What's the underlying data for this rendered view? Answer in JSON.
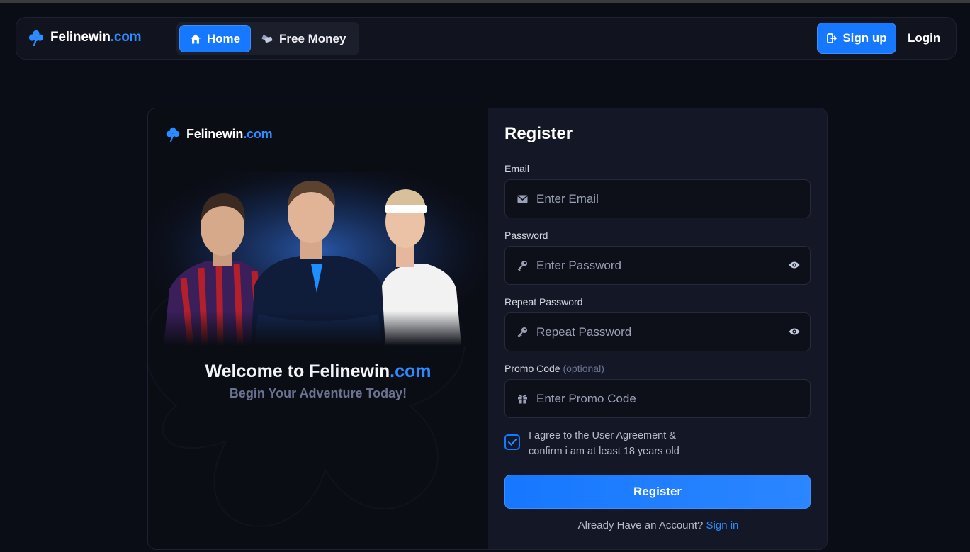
{
  "brand": {
    "name": "Felinewin",
    "tld": ".com"
  },
  "nav": {
    "home_label": "Home",
    "free_money_label": "Free Money",
    "signup_label": "Sign up",
    "login_label": "Login"
  },
  "left": {
    "welcome_prefix": "Welcome to Felinewin",
    "welcome_suffix": ".com",
    "subtitle": "Begin Your Adventure Today!"
  },
  "register": {
    "title": "Register",
    "email_label": "Email",
    "email_placeholder": "Enter Email",
    "password_label": "Password",
    "password_placeholder": "Enter Password",
    "repeat_label": "Repeat Password",
    "repeat_placeholder": "Repeat Password",
    "promo_label": "Promo Code",
    "promo_optional": "(optional)",
    "promo_placeholder": "Enter Promo Code",
    "agree_line1": "I agree to the User Agreement &",
    "agree_line2": "confirm i am at least 18 years old",
    "agree_checked": true,
    "submit_label": "Register",
    "already_text": "Already Have an Account?",
    "signin_link": "Sign in"
  },
  "colors": {
    "accent": "#1677ff",
    "link": "#2b8cff",
    "background": "#0b0d16",
    "panel": "#141826"
  },
  "icons": [
    "clover-icon",
    "home-icon",
    "money-icon",
    "signup-icon",
    "mail-icon",
    "key-icon",
    "eye-icon",
    "gift-icon",
    "check-icon"
  ]
}
